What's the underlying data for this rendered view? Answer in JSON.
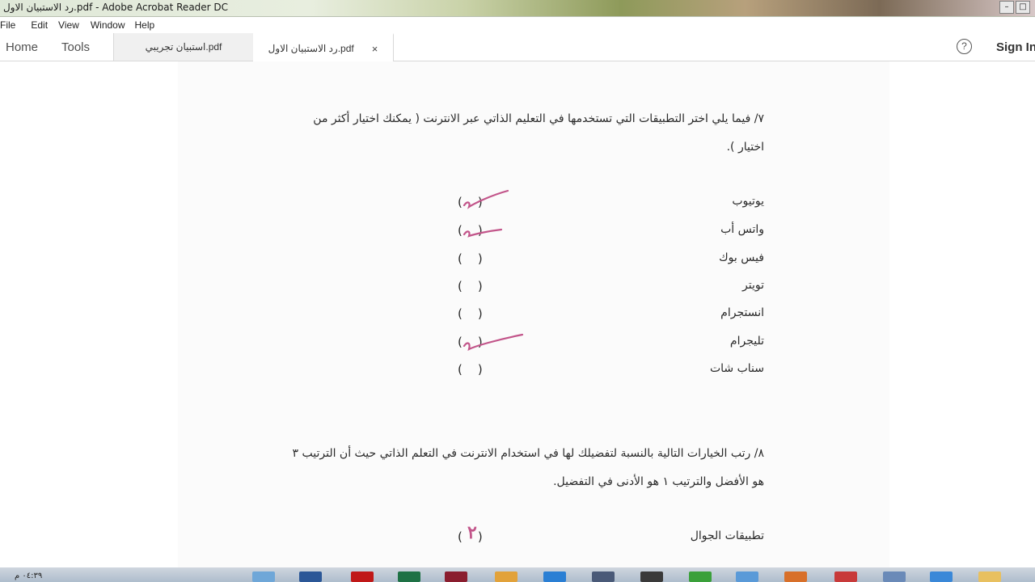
{
  "window": {
    "title": "رد الاستبيان الاول.pdf - Adobe Acrobat Reader DC",
    "controls": [
      "–",
      "□"
    ]
  },
  "menu": [
    "File",
    "Edit",
    "View",
    "Window",
    "Help"
  ],
  "toolbar": {
    "home": "Home",
    "tools": "Tools",
    "tabs": [
      {
        "label": "استبيان تجريبي.pdf",
        "active": false
      },
      {
        "label": "رد الاستبيان الاول.pdf",
        "active": true,
        "close": "×"
      }
    ],
    "help": "?",
    "sign_in": "Sign In"
  },
  "document": {
    "q7": {
      "line1": "٧/ فيما يلي اختر التطبيقات التي تستخدمها في التعليم الذاتي عبر الانترنت ( يمكنك اختيار أكثر من",
      "line2": "اختيار )."
    },
    "apps": [
      {
        "label": "يوتيوب",
        "paren": "(    )",
        "checked": true
      },
      {
        "label": "واتس أب",
        "paren": "(    )",
        "checked": true
      },
      {
        "label": "فيس بوك",
        "paren": "(    )",
        "checked": false
      },
      {
        "label": "تويتر",
        "paren": "(    )",
        "checked": false
      },
      {
        "label": "انستجرام",
        "paren": "(    )",
        "checked": false
      },
      {
        "label": "تليجرام",
        "paren": "(    )",
        "checked": true
      },
      {
        "label": "سناب شات",
        "paren": "(    )",
        "checked": false
      }
    ],
    "q8": {
      "line1": "٨/ رتب الخيارات التالية بالنسبة لتفضيلك لها في استخدام الانترنت في التعلم الذاتي حيث أن الترتيب ٣",
      "line2": "هو الأفضل والترتيب ١ هو الأدنى في التفضيل."
    },
    "rank_items": [
      {
        "label": "تطبيقات الجوال",
        "paren": "(    )",
        "rank": "٢"
      }
    ],
    "ink_color": "#c2558a"
  },
  "taskbar": {
    "clock": "٠٤:٣٩ م"
  }
}
